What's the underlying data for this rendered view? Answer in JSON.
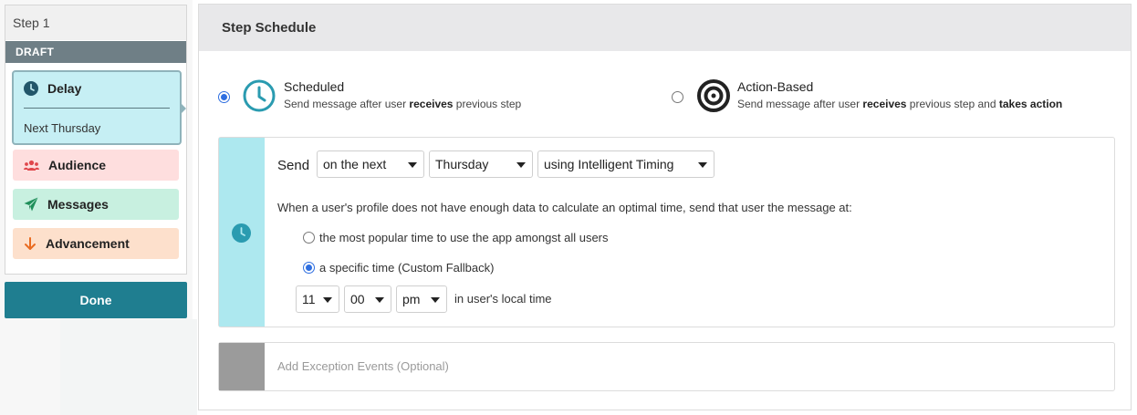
{
  "sidebar": {
    "step_label": "Step 1",
    "status": "DRAFT",
    "delay": {
      "title": "Delay",
      "subtitle": "Next Thursday"
    },
    "items": [
      {
        "label": "Audience",
        "icon": "users-icon",
        "color": "#e0474c"
      },
      {
        "label": "Messages",
        "icon": "paper-plane-icon",
        "color": "#1f8f5a"
      },
      {
        "label": "Advancement",
        "icon": "arrow-down-icon",
        "color": "#e96b21"
      }
    ],
    "done_label": "Done"
  },
  "main": {
    "title": "Step Schedule",
    "options": {
      "scheduled": {
        "title": "Scheduled",
        "desc_pre": "Send message after user ",
        "desc_bold": "receives",
        "desc_post": " previous step",
        "selected": true
      },
      "action": {
        "title": "Action-Based",
        "desc_pre": "Send message after user ",
        "desc_bold": "receives",
        "desc_mid": " previous step and ",
        "desc_bold2": "takes action",
        "selected": false
      }
    },
    "send": {
      "label": "Send",
      "when": "on the next",
      "day": "Thursday",
      "timing": "using Intelligent Timing",
      "fallback_text": "When a user's profile does not have enough data to calculate an optimal time, send that user the message at:",
      "option_popular": "the most popular time to use the app amongst all users",
      "option_specific": "a specific time (Custom Fallback)",
      "hour": "11",
      "minute": "00",
      "ampm": "pm",
      "suffix": "in user's local time"
    },
    "exception_label": "Add Exception Events (Optional)"
  },
  "colors": {
    "accent": "#1f7e90",
    "radio_selected": "#2f6fe0",
    "clock": "#2a9bb0"
  }
}
